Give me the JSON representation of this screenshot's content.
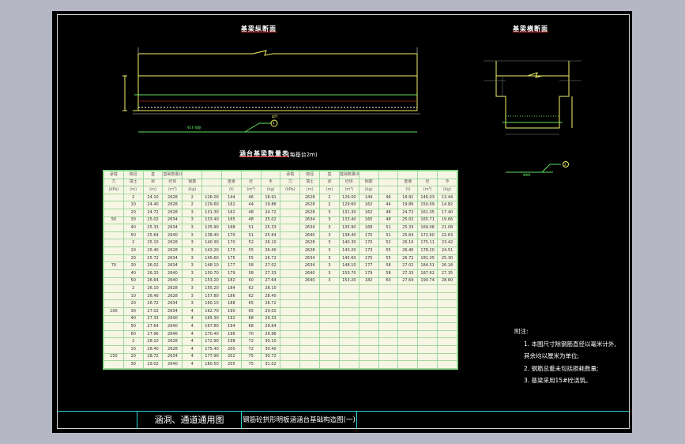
{
  "drawing": {
    "title_long_section": "基梁纵断面",
    "title_cross_section": "基梁横断面",
    "table_title": "涵台基梁数量表",
    "table_subtitle": "(每基台2m)",
    "dim_bottom": "ΔYY",
    "rebar_label": "Φ16 钢筋",
    "rebar_tag": "1",
    "rebar_tag_right": "2",
    "rebar_label_right": "ΦΦΦ"
  },
  "table": {
    "header_row1": [
      "承载",
      "跨径",
      "基",
      "基础数量(每米)",
      "",
      "",
      "",
      "",
      ""
    ],
    "header_row2": [
      "力",
      "填土",
      "梁",
      "砼体",
      "钢筋",
      "",
      "重量",
      "砼",
      "Φ"
    ],
    "header_row3": [
      "(kPa)",
      "(m)",
      "(m)",
      "(m³)",
      "(kg)",
      "",
      "(t)",
      "(m³)",
      "(kg)"
    ],
    "groups": [
      {
        "load": "50",
        "rows": [
          [
            "2",
            "24.10",
            "2628",
            "2",
            "126.00",
            "144",
            "46",
            "18.91",
            "146.03",
            "13.44"
          ],
          [
            "10",
            "24.40",
            "2628",
            "2",
            "129.60",
            "162",
            "44",
            "19.86",
            "150.09",
            "14.82"
          ],
          [
            "20",
            "24.72",
            "2628",
            "3",
            "131.30",
            "162",
            "48",
            "24.72",
            "161.35",
            "17.40"
          ],
          [
            "30",
            "25.02",
            "2634",
            "3",
            "133.40",
            "165",
            "48",
            "25.02",
            "165.71",
            "19.66"
          ],
          [
            "40",
            "25.33",
            "2634",
            "3",
            "135.90",
            "168",
            "51",
            "25.33",
            "169.08",
            "21.08"
          ],
          [
            "50",
            "25.64",
            "2640",
            "3",
            "138.40",
            "170",
            "51",
            "25.64",
            "172.60",
            "22.63"
          ]
        ]
      },
      {
        "load": "70",
        "rows": [
          [
            "2",
            "25.10",
            "2628",
            "3",
            "140.30",
            "170",
            "52",
            "26.10",
            "175.11",
            "23.42"
          ],
          [
            "10",
            "25.40",
            "2628",
            "3",
            "143.20",
            "173",
            "55",
            "26.40",
            "178.20",
            "24.51"
          ],
          [
            "20",
            "25.72",
            "2634",
            "3",
            "145.60",
            "175",
            "55",
            "26.72",
            "181.35",
            "25.30"
          ],
          [
            "30",
            "26.02",
            "2634",
            "3",
            "148.10",
            "177",
            "58",
            "27.02",
            "184.51",
            "26.18"
          ],
          [
            "40",
            "26.33",
            "2640",
            "3",
            "150.70",
            "179",
            "58",
            "27.33",
            "187.62",
            "27.35"
          ],
          [
            "50",
            "26.64",
            "2640",
            "3",
            "153.20",
            "182",
            "60",
            "27.64",
            "190.74",
            "28.60"
          ]
        ]
      },
      {
        "load": "100",
        "rows": [
          [
            "2",
            "26.10",
            "2628",
            "3",
            "155.20",
            "184",
            "62",
            "28.10",
            "193.52",
            "29.12"
          ],
          [
            "10",
            "26.40",
            "2628",
            "3",
            "157.80",
            "186",
            "62",
            "28.40",
            "196.41",
            "30.27"
          ],
          [
            "20",
            "26.72",
            "2634",
            "3",
            "160.10",
            "188",
            "65",
            "28.72",
            "199.30",
            "31.40"
          ],
          [
            "30",
            "27.02",
            "2634",
            "4",
            "162.70",
            "190",
            "65",
            "29.02",
            "202.21",
            "32.55"
          ],
          [
            "40",
            "27.33",
            "2640",
            "4",
            "165.30",
            "192",
            "68",
            "29.33",
            "205.15",
            "33.74"
          ],
          [
            "50",
            "27.64",
            "2640",
            "4",
            "167.80",
            "194",
            "68",
            "29.64",
            "208.03",
            "34.86"
          ],
          [
            "60",
            "27.96",
            "2646",
            "4",
            "170.40",
            "196",
            "70",
            "29.96",
            "211.10",
            "35.90"
          ]
        ]
      },
      {
        "load": "150",
        "rows": [
          [
            "2",
            "28.10",
            "2628",
            "4",
            "172.90",
            "198",
            "72",
            "30.10",
            "213.94",
            "36.97"
          ],
          [
            "10",
            "28.40",
            "2628",
            "4",
            "175.40",
            "200",
            "72",
            "30.40",
            "216.80",
            "38.04"
          ],
          [
            "20",
            "28.72",
            "2634",
            "4",
            "177.90",
            "202",
            "75",
            "30.72",
            "219.71",
            "39.12"
          ],
          [
            "30",
            "29.02",
            "2640",
            "4",
            "180.50",
            "205",
            "75",
            "31.02",
            "222.56",
            "40.18"
          ]
        ]
      }
    ]
  },
  "notes": {
    "heading": "附注:",
    "items": [
      "1. 本图尺寸除钢筋直径以毫米计外,",
      "   其余均以厘米为单位;",
      "2. 钢筋总重未包括损耗数量;",
      "3. 基梁采用15#砼浇筑。"
    ]
  },
  "title_block": {
    "project": "涵洞、通道通用图",
    "drawing_name": "钢筋砼拱形明板涵涵台基础构造图(一)"
  },
  "colors": {
    "background": "#b6b7c5",
    "sheet": "#000000",
    "line_yellow": "#f4f46a",
    "line_green": "#5fe05f",
    "line_cyan": "#2fd3d8",
    "accent_red": "#ff3b30"
  }
}
